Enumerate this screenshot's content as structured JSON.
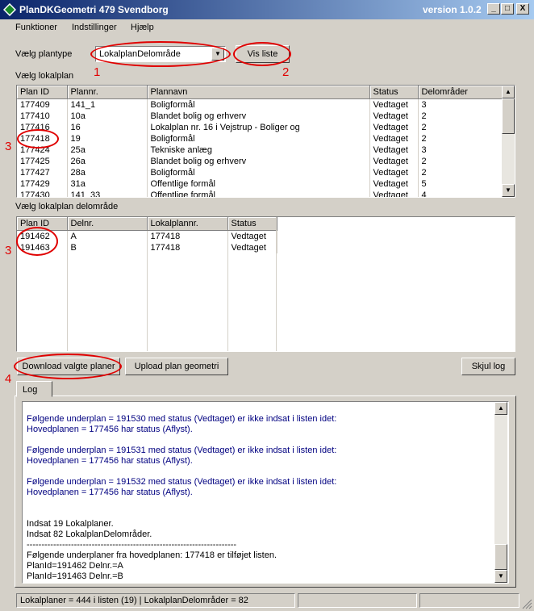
{
  "window": {
    "title": "PlanDKGeometri   479 Svendborg",
    "version": "version 1.0.2",
    "minimize": "_",
    "maximize": "□",
    "close": "X"
  },
  "menu": [
    "Funktioner",
    "Indstillinger",
    "Hjælp"
  ],
  "plantype": {
    "label": "Vælg plantype",
    "selected": "LokalplanDelområde",
    "show_button": "Vis liste"
  },
  "lokalplan": {
    "label": "Vælg lokalplan",
    "columns": [
      "Plan ID",
      "Plannr.",
      "Plannavn",
      "Status",
      "Delområder"
    ],
    "rows": [
      [
        "177409",
        "141_1",
        "Boligformål",
        "Vedtaget",
        "3"
      ],
      [
        "177410",
        "10a",
        "Blandet bolig og erhverv",
        "Vedtaget",
        "2"
      ],
      [
        "177416",
        "16",
        "Lokalplan nr. 16 i Vejstrup - Boliger og",
        "Vedtaget",
        "2"
      ],
      [
        "177418",
        "19",
        "Boligformål",
        "Vedtaget",
        "2"
      ],
      [
        "177424",
        "25a",
        "Tekniske anlæg",
        "Vedtaget",
        "3"
      ],
      [
        "177425",
        "26a",
        "Blandet bolig og erhverv",
        "Vedtaget",
        "2"
      ],
      [
        "177427",
        "28a",
        "Boligformål",
        "Vedtaget",
        "2"
      ],
      [
        "177429",
        "31a",
        "Offentlige formål",
        "Vedtaget",
        "5"
      ],
      [
        "177430",
        "141_33",
        "Offentlige formål",
        "Vedtaget",
        "4"
      ]
    ]
  },
  "delomraade": {
    "label": "Vælg lokalplan delområde",
    "columns": [
      "Plan ID",
      "Delnr.",
      "Lokalplannr.",
      "Status"
    ],
    "rows": [
      [
        "191462",
        "A",
        "177418",
        "Vedtaget"
      ],
      [
        "191463",
        "B",
        "177418",
        "Vedtaget"
      ]
    ]
  },
  "buttons": {
    "download": "Download valgte planer",
    "upload": "Upload plan geometri",
    "hide_log": "Skjul log"
  },
  "log": {
    "tab": "Log",
    "lines": [
      {
        "text": "",
        "color": "blue"
      },
      {
        "text": "Følgende underplan = 191530 med status (Vedtaget) er ikke indsat i listen idet:",
        "color": "blue"
      },
      {
        "text": "Hovedplanen = 177456 har status (Aflyst).",
        "color": "blue"
      },
      {
        "text": "",
        "color": "blue"
      },
      {
        "text": "Følgende underplan = 191531 med status (Vedtaget) er ikke indsat i listen idet:",
        "color": "blue"
      },
      {
        "text": "Hovedplanen = 177456 har status (Aflyst).",
        "color": "blue"
      },
      {
        "text": "",
        "color": "blue"
      },
      {
        "text": "Følgende underplan = 191532 med status (Vedtaget) er ikke indsat i listen idet:",
        "color": "blue"
      },
      {
        "text": "Hovedplanen = 177456 har status (Aflyst).",
        "color": "blue"
      },
      {
        "text": "",
        "color": "blue"
      },
      {
        "text": "",
        "color": "blue"
      },
      {
        "text": "Indsat 19 Lokalplaner.",
        "color": "black"
      },
      {
        "text": "Indsat 82 LokalplanDelområder.",
        "color": "black"
      },
      {
        "text": "-----------------------------------------------------------------------",
        "color": "black"
      },
      {
        "text": "Følgende underplaner fra hovedplanen: 177418 er tilføjet listen.",
        "color": "black"
      },
      {
        "text": "PlanId=191462 Delnr.=A",
        "color": "black"
      },
      {
        "text": "PlanId=191463 Delnr.=B",
        "color": "black"
      }
    ]
  },
  "status": {
    "text": "Lokalplaner = 444 i listen (19)  | LokalplanDelområder = 82"
  },
  "annotations": [
    "1",
    "2",
    "3",
    "3",
    "4"
  ],
  "colors": {
    "annotation": "#e00000",
    "log_blue": "#000080",
    "title_start": "#0a246a"
  }
}
